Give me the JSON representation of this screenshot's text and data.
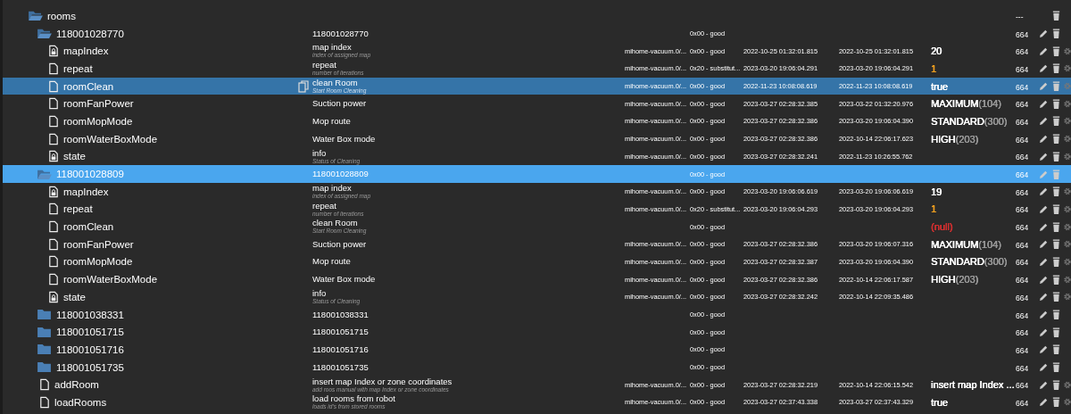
{
  "tree": [
    {
      "id": "rooms",
      "kind": "folder",
      "expanded": true,
      "selected": false,
      "hovered": false,
      "editable": false,
      "acl": "---",
      "children": [
        {
          "id": "118001028770",
          "kind": "folder",
          "expanded": true,
          "selected": false,
          "hovered": false,
          "editable": true,
          "name": "118001028770",
          "quality": "0x00 - good",
          "acl": "664",
          "children": [
            {
              "id": "mapIndex",
              "kind": "locked-state",
              "selected": false,
              "hovered": false,
              "editable": true,
              "name": "map index",
              "description": "index of assigned map",
              "source": "mihome-vacuum.0/...",
              "quality": "0x00 - good",
              "ts": "2022-10-25 01:32:01.815",
              "lc": "2022-10-25 01:32:01.815",
              "value": "20",
              "color": "#ffffff",
              "acl": "664"
            },
            {
              "id": "repeat",
              "kind": "state",
              "selected": false,
              "hovered": false,
              "editable": true,
              "name": "repeat",
              "description": "number of iterations",
              "source": "mihome-vacuum.0/...",
              "quality": "0x20 - substitut...",
              "ts": "2023-03-20 19:06:04.291",
              "lc": "2023-03-20 19:06:04.291",
              "value": "1",
              "color": "#f0a020",
              "acl": "664"
            },
            {
              "id": "roomClean",
              "kind": "state",
              "selected": true,
              "hovered": false,
              "editable": true,
              "name": "clean Room",
              "description": "Start Room Cleaning",
              "source": "mihome-vacuum.0/...",
              "quality": "0x00 - good",
              "ts": "2022-11-23 10:08:08.619",
              "lc": "2022-11-23 10:08:08.619",
              "value": "true",
              "color": "#ffffff",
              "acl": "664"
            },
            {
              "id": "roomFanPower",
              "kind": "state",
              "selected": false,
              "hovered": false,
              "editable": true,
              "name": "Suction power",
              "source": "mihome-vacuum.0/...",
              "quality": "0x00 - good",
              "ts": "2023-03-27 02:28:32.385",
              "lc": "2023-03-22 01:32:20.976",
              "value": "MAXIMUM",
              "value_code": "(104)",
              "color": "#ffffff",
              "acl": "664"
            },
            {
              "id": "roomMopMode",
              "kind": "state",
              "selected": false,
              "hovered": false,
              "editable": true,
              "name": "Mop route",
              "source": "mihome-vacuum.0/...",
              "quality": "0x00 - good",
              "ts": "2023-03-27 02:28:32.386",
              "lc": "2023-03-20 19:06:04.390",
              "value": "STANDARD",
              "value_code": "(300)",
              "color": "#ffffff",
              "acl": "664"
            },
            {
              "id": "roomWaterBoxMode",
              "kind": "state",
              "selected": false,
              "hovered": false,
              "editable": true,
              "name": "Water Box mode",
              "source": "mihome-vacuum.0/...",
              "quality": "0x00 - good",
              "ts": "2023-03-27 02:28:32.386",
              "lc": "2022-10-14 22:06:17.623",
              "value": "HIGH",
              "value_code": "(203)",
              "color": "#ffffff",
              "acl": "664"
            },
            {
              "id": "state",
              "kind": "locked-state",
              "selected": false,
              "hovered": false,
              "editable": true,
              "name": "info",
              "description": "Status of Cleaning",
              "source": "mihome-vacuum.0/...",
              "quality": "0x00 - good",
              "ts": "2023-03-27 02:28:32.241",
              "lc": "2022-11-23 10:26:55.762",
              "acl": "664"
            }
          ]
        },
        {
          "id": "118001028809",
          "kind": "folder",
          "expanded": true,
          "selected": false,
          "hovered": true,
          "editable": true,
          "name": "118001028809",
          "quality": "0x00 - good",
          "acl": "664",
          "children": [
            {
              "id": "mapIndex",
              "kind": "locked-state",
              "selected": false,
              "hovered": false,
              "editable": true,
              "name": "map index",
              "description": "index of assigned map",
              "source": "mihome-vacuum.0/...",
              "quality": "0x00 - good",
              "ts": "2023-03-20 19:06:06.619",
              "lc": "2023-03-20 19:06:06.619",
              "value": "19",
              "color": "#ffffff",
              "acl": "664"
            },
            {
              "id": "repeat",
              "kind": "state",
              "selected": false,
              "hovered": false,
              "editable": true,
              "name": "repeat",
              "description": "number of iterations",
              "source": "mihome-vacuum.0/...",
              "quality": "0x20 - substitut...",
              "ts": "2023-03-20 19:06:04.293",
              "lc": "2023-03-20 19:06:04.293",
              "value": "1",
              "color": "#f0a020",
              "acl": "664"
            },
            {
              "id": "roomClean",
              "kind": "state",
              "selected": false,
              "hovered": false,
              "editable": true,
              "name": "clean Room",
              "description": "Start Room Cleaning",
              "quality": "0x00 - good",
              "value": "(null)",
              "color": "#d03030",
              "acl": "664"
            },
            {
              "id": "roomFanPower",
              "kind": "state",
              "selected": false,
              "hovered": false,
              "editable": true,
              "name": "Suction power",
              "source": "mihome-vacuum.0/...",
              "quality": "0x00 - good",
              "ts": "2023-03-27 02:28:32.386",
              "lc": "2023-03-20 19:06:07.316",
              "value": "MAXIMUM",
              "value_code": "(104)",
              "color": "#ffffff",
              "acl": "664"
            },
            {
              "id": "roomMopMode",
              "kind": "state",
              "selected": false,
              "hovered": false,
              "editable": true,
              "name": "Mop route",
              "source": "mihome-vacuum.0/...",
              "quality": "0x00 - good",
              "ts": "2023-03-27 02:28:32.387",
              "lc": "2023-03-20 19:06:04.390",
              "value": "STANDARD",
              "value_code": "(300)",
              "color": "#ffffff",
              "acl": "664"
            },
            {
              "id": "roomWaterBoxMode",
              "kind": "state",
              "selected": false,
              "hovered": false,
              "editable": true,
              "name": "Water Box mode",
              "source": "mihome-vacuum.0/...",
              "quality": "0x00 - good",
              "ts": "2023-03-27 02:28:32.386",
              "lc": "2022-10-14 22:06:17.587",
              "value": "HIGH",
              "value_code": "(203)",
              "color": "#ffffff",
              "acl": "664"
            },
            {
              "id": "state",
              "kind": "locked-state",
              "selected": false,
              "hovered": false,
              "editable": true,
              "name": "info",
              "description": "Status of Cleaning",
              "source": "mihome-vacuum.0/...",
              "quality": "0x00 - good",
              "ts": "2023-03-27 02:28:32.242",
              "lc": "2022-10-14 22:09:35.486",
              "acl": "664"
            }
          ]
        },
        {
          "id": "118001038331",
          "kind": "folder",
          "expanded": false,
          "selected": false,
          "hovered": false,
          "editable": true,
          "name": "118001038331",
          "quality": "0x00 - good",
          "acl": "664"
        },
        {
          "id": "118001051715",
          "kind": "folder",
          "expanded": false,
          "selected": false,
          "hovered": false,
          "editable": true,
          "name": "118001051715",
          "quality": "0x00 - good",
          "acl": "664"
        },
        {
          "id": "118001051716",
          "kind": "folder",
          "expanded": false,
          "selected": false,
          "hovered": false,
          "editable": true,
          "name": "118001051716",
          "quality": "0x00 - good",
          "acl": "664"
        },
        {
          "id": "118001051735",
          "kind": "folder",
          "expanded": false,
          "selected": false,
          "hovered": false,
          "editable": true,
          "name": "118001051735",
          "quality": "0x00 - good",
          "acl": "664"
        },
        {
          "id": "addRoom",
          "kind": "state",
          "selected": false,
          "hovered": false,
          "editable": true,
          "name": "insert map Index or zone coordinates",
          "description": "add roos manual with map Index or zone coordinates",
          "source": "mihome-vacuum.0/...",
          "quality": "0x00 - good",
          "ts": "2023-03-27 02:28:32.219",
          "lc": "2022-10-14 22:06:15.542",
          "value": "insert map Index ...",
          "color": "#ffffff",
          "acl": "664"
        },
        {
          "id": "loadRooms",
          "kind": "state",
          "selected": false,
          "hovered": false,
          "editable": true,
          "name": "load rooms from robot",
          "description": "loads id's from stored rooms",
          "source": "mihome-vacuum.0/...",
          "quality": "0x00 - good",
          "ts": "2023-03-27 02:37:43.338",
          "lc": "2023-03-27 02:37:43.329",
          "value": "true",
          "color": "#ffffff",
          "acl": "664"
        }
      ]
    }
  ]
}
